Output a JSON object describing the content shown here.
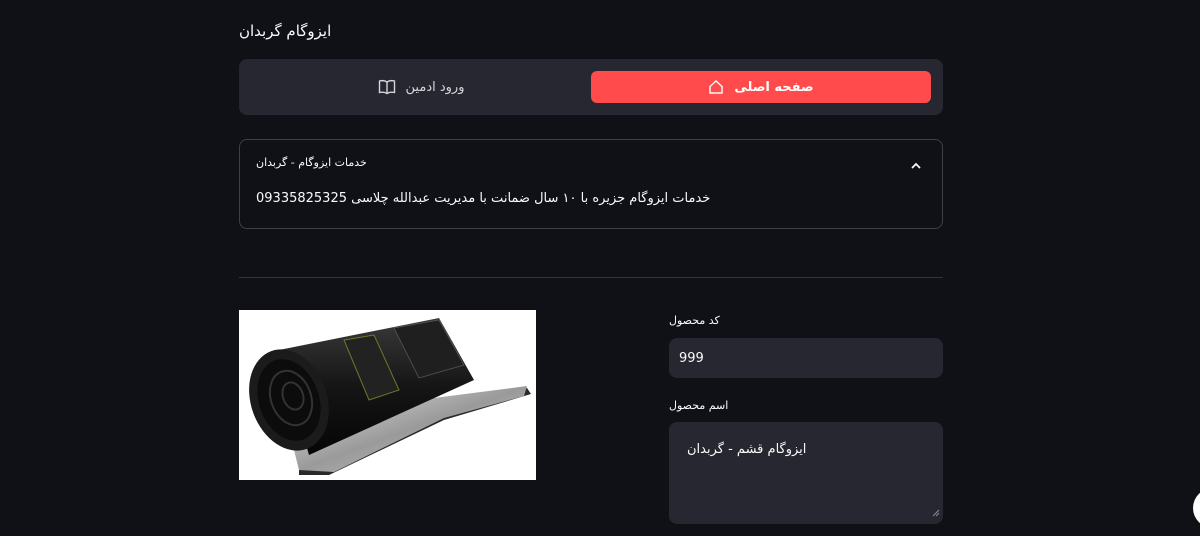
{
  "app": {
    "title": "ایزوگام گربدان"
  },
  "nav": {
    "home_label": "صفحه اصلی",
    "admin_label": "ورود ادمین",
    "active_color": "#ff4b4b"
  },
  "expander": {
    "header": "خدمات ایزوگام - گربدان",
    "body": "خدمات ایزوگام جزیره با ۱۰ سال ضمانت با مدیریت عبدالله چلاسی 09335825325"
  },
  "product": {
    "code_label": "کد محصول",
    "code_value": "999",
    "name_label": "اسم محصول",
    "name_value": "ایزوگام قشم - گربدان"
  },
  "icons": {
    "home": "home-icon",
    "admin": "book-icon",
    "expander": "chevron-up-icon"
  }
}
